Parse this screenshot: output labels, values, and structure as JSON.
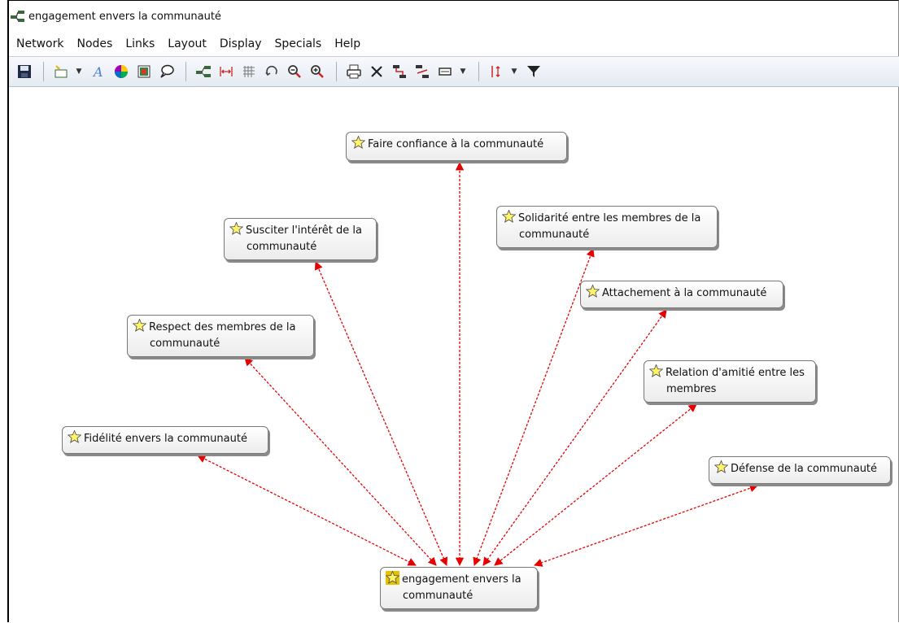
{
  "window": {
    "title": "engagement envers la communauté"
  },
  "menu": [
    "Network",
    "Nodes",
    "Links",
    "Layout",
    "Display",
    "Specials",
    "Help"
  ],
  "toolbar": {
    "icons": [
      "save-icon",
      "new-node-icon",
      "font-icon",
      "color-wheel-icon",
      "image-icon",
      "comment-icon",
      "network-icon",
      "spread-icon",
      "grid-icon",
      "undo-icon",
      "zoom-out-icon",
      "zoom-in-icon",
      "print-icon",
      "delete-icon",
      "link-icon",
      "link-icon-2",
      "display-icon",
      "sort-icon",
      "filter-icon"
    ]
  },
  "graph": {
    "link_color": "#e60000",
    "center": {
      "label_line1": "engagement envers la",
      "label_line2": "communauté"
    },
    "nodes": [
      {
        "id": "faire-confiance",
        "label_line1": "Faire confiance à la communauté",
        "label_line2": ""
      },
      {
        "id": "solidarite",
        "label_line1": "Solidarité entre les membres de la",
        "label_line2": "communauté"
      },
      {
        "id": "susciter",
        "label_line1": "Susciter l'intérêt de la",
        "label_line2": "communauté"
      },
      {
        "id": "attachement",
        "label_line1": "Attachement à la communauté",
        "label_line2": ""
      },
      {
        "id": "respect",
        "label_line1": "Respect des membres de la",
        "label_line2": "communauté"
      },
      {
        "id": "relation",
        "label_line1": "Relation d'amitié entre les",
        "label_line2": "membres"
      },
      {
        "id": "fidelite",
        "label_line1": "Fidélité envers la communauté",
        "label_line2": ""
      },
      {
        "id": "defense",
        "label_line1": "Défense de la communauté",
        "label_line2": ""
      }
    ]
  }
}
